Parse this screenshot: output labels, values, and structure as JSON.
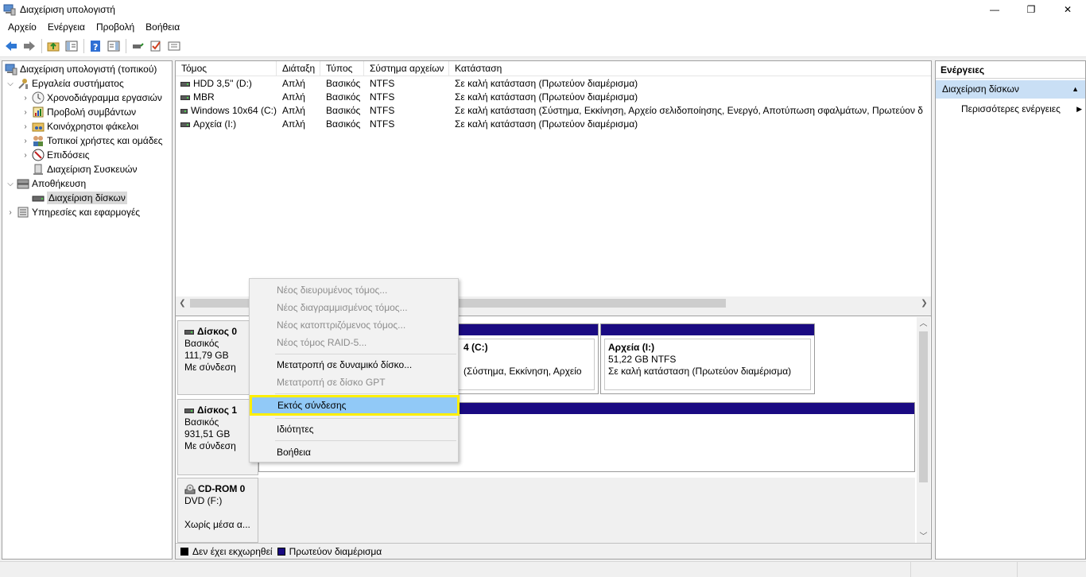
{
  "window": {
    "title": "Διαχείριση υπολογιστή",
    "minimize": "—",
    "maximize": "❐",
    "close": "✕"
  },
  "menubar": [
    "Αρχείο",
    "Ενέργεια",
    "Προβολή",
    "Βοήθεια"
  ],
  "tree": {
    "root": "Διαχείριση υπολογιστή (τοπικού)",
    "system_tools": "Εργαλεία συστήματος",
    "task_scheduler": "Χρονοδιάγραμμα εργασιών",
    "event_viewer": "Προβολή συμβάντων",
    "shared_folders": "Κοινόχρηστοι φάκελοι",
    "local_users": "Τοπικοί χρήστες και ομάδες",
    "performance": "Επιδόσεις",
    "device_manager": "Διαχείριση Συσκευών",
    "storage": "Αποθήκευση",
    "disk_management": "Διαχείριση δίσκων",
    "services_apps": "Υπηρεσίες και εφαρμογές"
  },
  "volume_table": {
    "headers": [
      "Τόμος",
      "Διάταξη",
      "Τύπος",
      "Σύστημα αρχείων",
      "Κατάσταση"
    ],
    "rows": [
      [
        "HDD 3,5'' (D:)",
        "Απλή",
        "Βασικός",
        "NTFS",
        "Σε καλή κατάσταση (Πρωτεύον διαμέρισμα)"
      ],
      [
        "MBR",
        "Απλή",
        "Βασικός",
        "NTFS",
        "Σε καλή κατάσταση (Πρωτεύον διαμέρισμα)"
      ],
      [
        "Windows 10x64 (C:)",
        "Απλή",
        "Βασικός",
        "NTFS",
        "Σε καλή κατάσταση (Σύστημα, Εκκίνηση, Αρχείο σελιδοποίησης, Ενεργό, Αποτύπωση σφαλμάτων, Πρωτεύον δ"
      ],
      [
        "Αρχεία (I:)",
        "Απλή",
        "Βασικός",
        "NTFS",
        "Σε καλή κατάσταση (Πρωτεύον διαμέρισμα)"
      ]
    ]
  },
  "disks": {
    "disk0": {
      "name": "Δίσκος 0",
      "type": "Βασικός",
      "size": "111,79 GB",
      "status": "Με σύνδεση"
    },
    "disk1": {
      "name": "Δίσκος 1",
      "type": "Βασικός",
      "size": "931,51 GB",
      "status": "Με σύνδεση"
    },
    "cdrom0": {
      "name": "CD-ROM 0",
      "drive": "DVD (F:)",
      "status": "Χωρίς μέσα α..."
    }
  },
  "partitions": {
    "c_partial_title": "4 (C:)",
    "c_partial_status": "(Σύστημα, Εκκίνηση, Αρχείο",
    "archive_title": "Αρχεία  (I:)",
    "archive_size": "51,22 GB NTFS",
    "archive_status": "Σε καλή κατάσταση (Πρωτεύον διαμέρισμα)"
  },
  "legend": {
    "unallocated": "Δεν έχει εκχωρηθεί",
    "primary": "Πρωτεύον διαμέρισμα",
    "unallocated_color": "#000000",
    "primary_color": "#1a0a82"
  },
  "actions": {
    "title": "Ενέργειες",
    "group": "Διαχείριση δίσκων",
    "more": "Περισσότερες ενέργειες"
  },
  "context_menu": {
    "new_spanned": "Νέος διευρυμένος τόμος...",
    "new_striped": "Νέος διαγραμμισμένος τόμος...",
    "new_mirrored": "Νέος κατοπτριζόμενος τόμος...",
    "new_raid5": "Νέος τόμος RAID-5...",
    "convert_dynamic": "Μετατροπή σε δυναμικό δίσκο...",
    "convert_gpt": "Μετατροπή σε δίσκο GPT",
    "offline": "Εκτός σύνδεσης",
    "properties": "Ιδιότητες",
    "help": "Βοήθεια"
  },
  "colors": {
    "highlight_fill": "#91c9f7",
    "highlight_border": "#ffef00",
    "action_group_bg": "#c9dff5"
  }
}
